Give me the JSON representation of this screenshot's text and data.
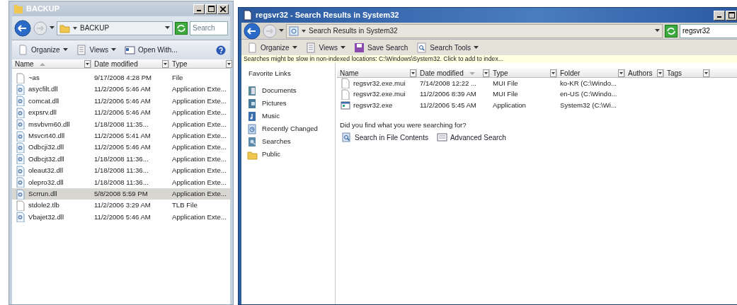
{
  "left_window": {
    "title": "BACKUP",
    "address": "BACKUP",
    "search": {
      "placeholder": "Search"
    },
    "toolbar": [
      {
        "label": "Organize",
        "kind": "organize",
        "menu": true
      },
      {
        "label": "Views",
        "kind": "views",
        "menu": true
      },
      {
        "label": "Open With...",
        "kind": "open",
        "menu": false
      }
    ],
    "columns": [
      {
        "label": "Name",
        "sorted": true,
        "descending": false
      },
      {
        "label": "Date modified",
        "sorted": false
      },
      {
        "label": "Type",
        "sorted": false
      }
    ],
    "rows": [
      {
        "name": "~as",
        "date": "9/17/2008 4:28 PM",
        "type": "File",
        "kind": "blank",
        "selected": false
      },
      {
        "name": "asycfilt.dll",
        "date": "11/2/2006 5:46 AM",
        "type": "Application Exte...",
        "kind": "dll",
        "selected": false
      },
      {
        "name": "comcat.dll",
        "date": "11/2/2006 5:46 AM",
        "type": "Application Exte...",
        "kind": "dll",
        "selected": false
      },
      {
        "name": "expsrv.dll",
        "date": "11/2/2006 5:46 AM",
        "type": "Application Exte...",
        "kind": "dll",
        "selected": false
      },
      {
        "name": "msvbvm60.dll",
        "date": "1/18/2008 11:35...",
        "type": "Application Exte...",
        "kind": "dll",
        "selected": false
      },
      {
        "name": "Msvcrt40.dll",
        "date": "11/2/2006 5:41 AM",
        "type": "Application Exte...",
        "kind": "dll",
        "selected": false
      },
      {
        "name": "Odbcji32.dll",
        "date": "11/2/2006 5:46 AM",
        "type": "Application Exte...",
        "kind": "dll",
        "selected": false
      },
      {
        "name": "Odbcjt32.dll",
        "date": "1/18/2008 11:36...",
        "type": "Application Exte...",
        "kind": "dll",
        "selected": false
      },
      {
        "name": "oleaut32.dll",
        "date": "1/18/2008 11:36...",
        "type": "Application Exte...",
        "kind": "dll",
        "selected": false
      },
      {
        "name": "olepro32.dll",
        "date": "1/18/2008 11:36...",
        "type": "Application Exte...",
        "kind": "dll",
        "selected": false
      },
      {
        "name": "Scrrun.dll",
        "date": "5/8/2008 5:59 PM",
        "type": "Application Exte...",
        "kind": "dll",
        "selected": true
      },
      {
        "name": "stdole2.tlb",
        "date": "11/2/2006 3:29 AM",
        "type": "TLB File",
        "kind": "blank",
        "selected": false
      },
      {
        "name": "Vbajet32.dll",
        "date": "11/2/2006 5:46 AM",
        "type": "Application Exte...",
        "kind": "dll",
        "selected": false
      }
    ]
  },
  "right_window": {
    "title": "regsvr32 - Search Results in System32",
    "address": "Search Results in System32",
    "search": {
      "value": "regsvr32"
    },
    "toolbar": [
      {
        "label": "Organize",
        "kind": "organize",
        "menu": true
      },
      {
        "label": "Views",
        "kind": "views",
        "menu": true
      },
      {
        "label": "Save Search",
        "kind": "save",
        "menu": false
      },
      {
        "label": "Search Tools",
        "kind": "searchtools",
        "menu": true
      }
    ],
    "info_bar": "Searches might be slow in non-indexed locations: C:\\Windows\\System32. Click to add to index...",
    "favorite_links": {
      "title": "Favorite Links",
      "items": [
        {
          "label": "Documents",
          "kind": "documents"
        },
        {
          "label": "Pictures",
          "kind": "pictures"
        },
        {
          "label": "Music",
          "kind": "music"
        },
        {
          "label": "Recently Changed",
          "kind": "recent"
        },
        {
          "label": "Searches",
          "kind": "searches"
        },
        {
          "label": "Public",
          "kind": "folder"
        }
      ]
    },
    "columns": [
      {
        "label": "Name",
        "sorted": false
      },
      {
        "label": "Date modified",
        "sorted": true,
        "descending": true
      },
      {
        "label": "Type",
        "sorted": false
      },
      {
        "label": "Folder",
        "sorted": false
      },
      {
        "label": "Authors",
        "sorted": false
      },
      {
        "label": "Tags",
        "sorted": false
      }
    ],
    "rows": [
      {
        "name": "regsvr32.exe.mui",
        "date": "7/14/2008 12:22 ...",
        "type": "MUI File",
        "folder": "ko-KR (C:\\Windo...",
        "kind": "blank"
      },
      {
        "name": "regsvr32.exe.mui",
        "date": "11/2/2006 8:39 AM",
        "type": "MUI File",
        "folder": "en-US (C:\\Windo...",
        "kind": "blank"
      },
      {
        "name": "regsvr32.exe",
        "date": "11/2/2006 5:45 AM",
        "type": "Application",
        "folder": "System32 (C:\\Wi...",
        "kind": "exe"
      }
    ],
    "prompt": "Did you find what you were searching for?",
    "actions": [
      {
        "label": "Search in File Contents",
        "kind": "contents"
      },
      {
        "label": "Advanced Search",
        "kind": "advanced"
      }
    ]
  }
}
